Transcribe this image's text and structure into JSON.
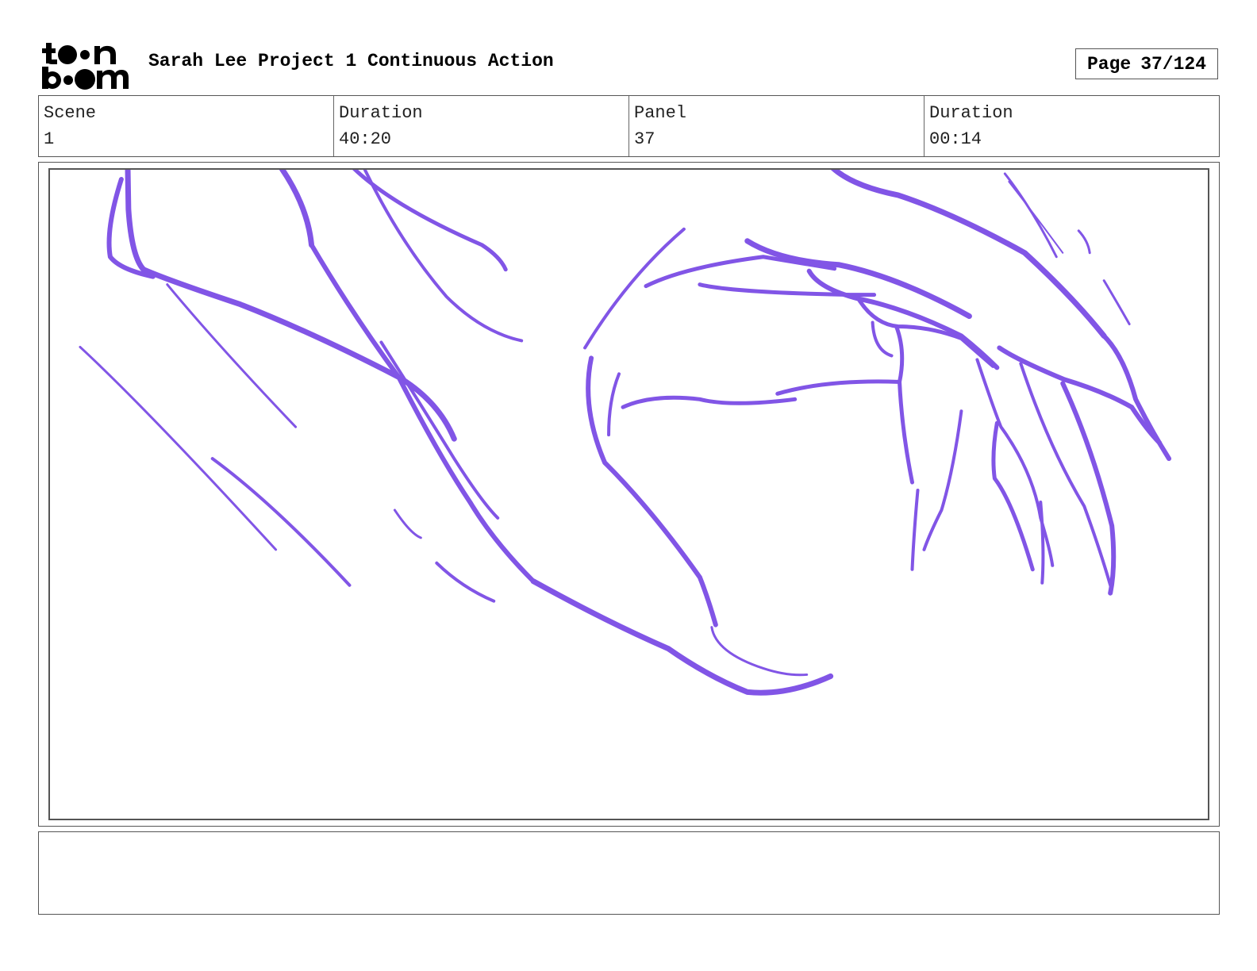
{
  "header": {
    "logo_icon": "toon-boom-logo-icon",
    "project_title": "Sarah Lee Project 1 Continuous Action",
    "page_label": "Page",
    "page_value": "37/124"
  },
  "info": [
    {
      "label": "Scene",
      "value": "1"
    },
    {
      "label": "Duration",
      "value": "40:20"
    },
    {
      "label": "Panel",
      "value": "37"
    },
    {
      "label": "Duration",
      "value": "00:14"
    }
  ],
  "panel": {
    "sketch_color": "#8155e6",
    "sketch_icon": "hand-sketch-drawing"
  },
  "notes": {
    "text": ""
  }
}
